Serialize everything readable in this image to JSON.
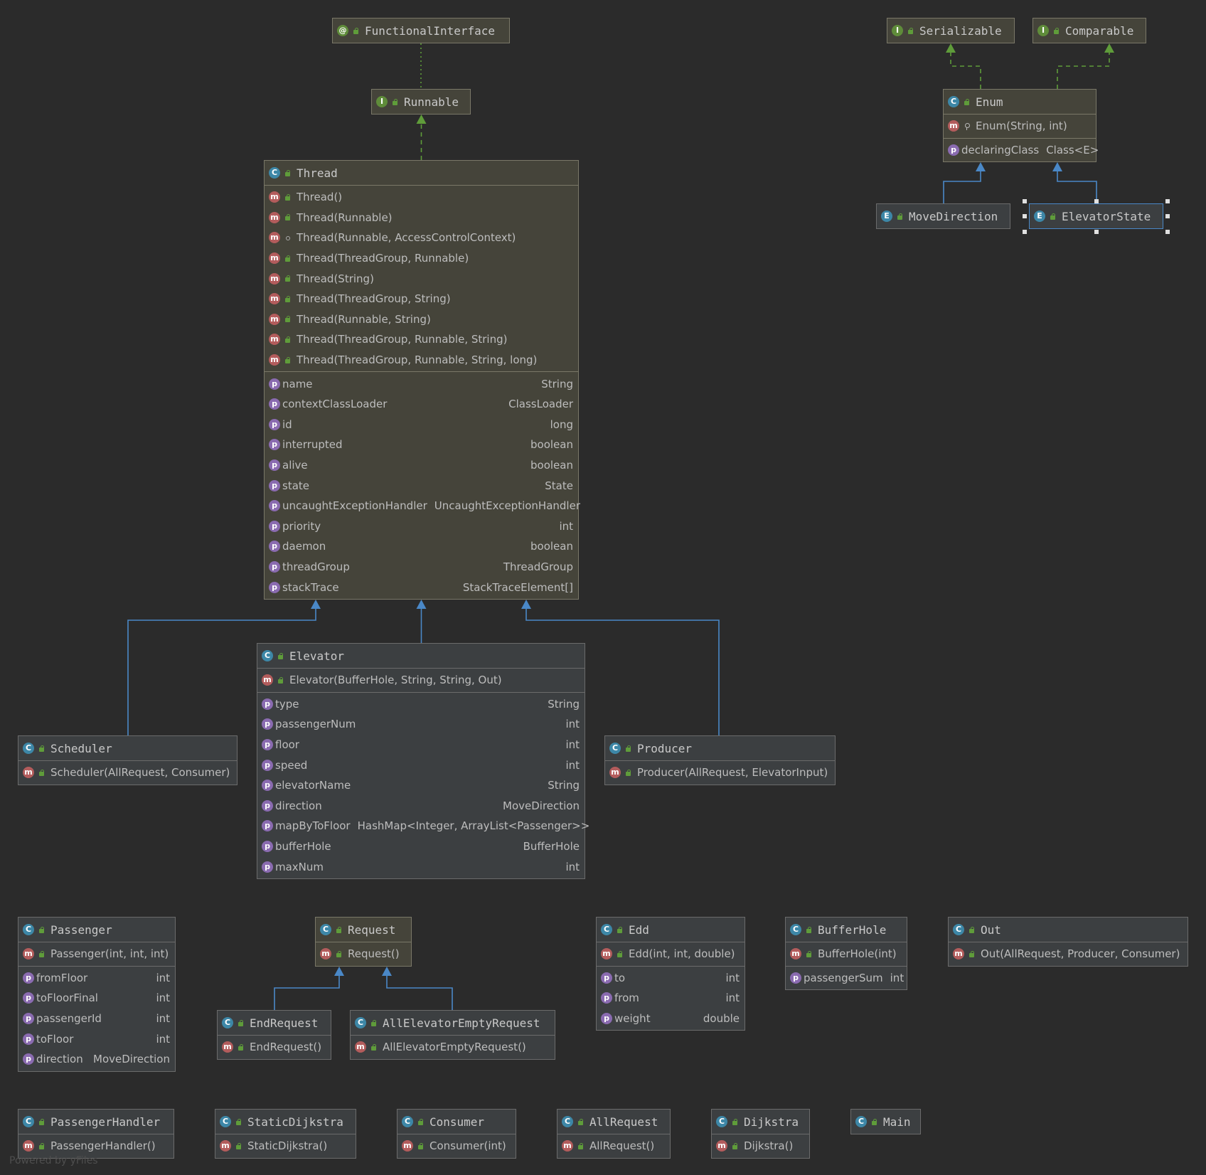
{
  "diagram": {
    "nodes": [
      {
        "id": "functionalinterface",
        "kind": "annotation",
        "name": "FunctionalInterface"
      },
      {
        "id": "runnable",
        "kind": "interface",
        "name": "Runnable"
      },
      {
        "id": "serializable",
        "kind": "interface",
        "name": "Serializable"
      },
      {
        "id": "comparable",
        "kind": "interface",
        "name": "Comparable"
      },
      {
        "id": "enum",
        "kind": "abstract-class",
        "name": "Enum",
        "methods": [
          {
            "vis": "private",
            "text": "Enum(String, int)"
          }
        ],
        "fields": [
          {
            "vis": "public",
            "name": "declaringClass",
            "type": "Class<E>"
          }
        ]
      },
      {
        "id": "movedirection",
        "kind": "enum",
        "name": "MoveDirection"
      },
      {
        "id": "elevatorstate",
        "kind": "enum",
        "name": "ElevatorState",
        "selected": true
      },
      {
        "id": "thread",
        "kind": "class",
        "name": "Thread",
        "methods": [
          {
            "vis": "public",
            "text": "Thread()"
          },
          {
            "vis": "public",
            "text": "Thread(Runnable)"
          },
          {
            "vis": "package",
            "text": "Thread(Runnable, AccessControlContext)"
          },
          {
            "vis": "public",
            "text": "Thread(ThreadGroup, Runnable)"
          },
          {
            "vis": "public",
            "text": "Thread(String)"
          },
          {
            "vis": "public",
            "text": "Thread(ThreadGroup, String)"
          },
          {
            "vis": "public",
            "text": "Thread(Runnable, String)"
          },
          {
            "vis": "public",
            "text": "Thread(ThreadGroup, Runnable, String)"
          },
          {
            "vis": "public",
            "text": "Thread(ThreadGroup, Runnable, String, long)"
          }
        ],
        "fields": [
          {
            "name": "name",
            "type": "String"
          },
          {
            "name": "contextClassLoader",
            "type": "ClassLoader"
          },
          {
            "name": "id",
            "type": "long"
          },
          {
            "name": "interrupted",
            "type": "boolean"
          },
          {
            "name": "alive",
            "type": "boolean"
          },
          {
            "name": "state",
            "type": "State"
          },
          {
            "name": "uncaughtExceptionHandler",
            "type": "UncaughtExceptionHandler"
          },
          {
            "name": "priority",
            "type": "int"
          },
          {
            "name": "daemon",
            "type": "boolean"
          },
          {
            "name": "threadGroup",
            "type": "ThreadGroup"
          },
          {
            "name": "stackTrace",
            "type": "StackTraceElement[]"
          }
        ]
      },
      {
        "id": "elevator",
        "kind": "class",
        "name": "Elevator",
        "methods": [
          {
            "vis": "public",
            "text": "Elevator(BufferHole, String, String, Out)"
          }
        ],
        "fields": [
          {
            "name": "type",
            "type": "String"
          },
          {
            "name": "passengerNum",
            "type": "int"
          },
          {
            "name": "floor",
            "type": "int"
          },
          {
            "name": "speed",
            "type": "int"
          },
          {
            "name": "elevatorName",
            "type": "String"
          },
          {
            "name": "direction",
            "type": "MoveDirection"
          },
          {
            "name": "mapByToFloor",
            "type": "HashMap<Integer, ArrayList<Passenger>>"
          },
          {
            "name": "bufferHole",
            "type": "BufferHole"
          },
          {
            "name": "maxNum",
            "type": "int"
          }
        ]
      },
      {
        "id": "scheduler",
        "kind": "class",
        "name": "Scheduler",
        "methods": [
          {
            "vis": "public",
            "text": "Scheduler(AllRequest, Consumer)"
          }
        ]
      },
      {
        "id": "producer",
        "kind": "class",
        "name": "Producer",
        "methods": [
          {
            "vis": "public",
            "text": "Producer(AllRequest, ElevatorInput)"
          }
        ]
      },
      {
        "id": "passenger",
        "kind": "class",
        "name": "Passenger",
        "methods": [
          {
            "vis": "public",
            "text": "Passenger(int, int, int)"
          }
        ],
        "fields": [
          {
            "name": "fromFloor",
            "type": "int"
          },
          {
            "name": "toFloorFinal",
            "type": "int"
          },
          {
            "name": "passengerId",
            "type": "int"
          },
          {
            "name": "toFloor",
            "type": "int"
          },
          {
            "name": "direction",
            "type": "MoveDirection"
          }
        ]
      },
      {
        "id": "request",
        "kind": "class",
        "name": "Request",
        "methods": [
          {
            "vis": "public",
            "text": "Request()"
          }
        ]
      },
      {
        "id": "endrequest",
        "kind": "class",
        "name": "EndRequest",
        "methods": [
          {
            "vis": "public",
            "text": "EndRequest()"
          }
        ]
      },
      {
        "id": "allelevatoremptyrequest",
        "kind": "class",
        "name": "AllElevatorEmptyRequest",
        "methods": [
          {
            "vis": "public",
            "text": "AllElevatorEmptyRequest()"
          }
        ]
      },
      {
        "id": "edd",
        "kind": "class",
        "name": "Edd",
        "methods": [
          {
            "vis": "public",
            "text": "Edd(int, int, double)"
          }
        ],
        "fields": [
          {
            "name": "to",
            "type": "int"
          },
          {
            "name": "from",
            "type": "int"
          },
          {
            "name": "weight",
            "type": "double"
          }
        ]
      },
      {
        "id": "bufferhole",
        "kind": "class",
        "name": "BufferHole",
        "methods": [
          {
            "vis": "public",
            "text": "BufferHole(int)"
          }
        ],
        "fields": [
          {
            "name": "passengerSum",
            "type": "int"
          }
        ]
      },
      {
        "id": "out",
        "kind": "class",
        "name": "Out",
        "methods": [
          {
            "vis": "public",
            "text": "Out(AllRequest, Producer, Consumer)"
          }
        ]
      },
      {
        "id": "passengerhandler",
        "kind": "class",
        "name": "PassengerHandler",
        "methods": [
          {
            "vis": "public",
            "text": "PassengerHandler()"
          }
        ]
      },
      {
        "id": "staticdijkstra",
        "kind": "class",
        "name": "StaticDijkstra",
        "methods": [
          {
            "vis": "public",
            "text": "StaticDijkstra()"
          }
        ]
      },
      {
        "id": "consumer",
        "kind": "class",
        "name": "Consumer",
        "methods": [
          {
            "vis": "public",
            "text": "Consumer(int)"
          }
        ]
      },
      {
        "id": "allrequest",
        "kind": "class",
        "name": "AllRequest",
        "methods": [
          {
            "vis": "public",
            "text": "AllRequest()"
          }
        ]
      },
      {
        "id": "dijkstra",
        "kind": "class",
        "name": "Dijkstra",
        "methods": [
          {
            "vis": "public",
            "text": "Dijkstra()"
          }
        ]
      },
      {
        "id": "main",
        "kind": "main-class",
        "name": "Main"
      }
    ],
    "edges": [
      {
        "from": "runnable",
        "to": "functionalinterface",
        "type": "annotation"
      },
      {
        "from": "thread",
        "to": "runnable",
        "type": "implements"
      },
      {
        "from": "enum",
        "to": "serializable",
        "type": "implements"
      },
      {
        "from": "enum",
        "to": "comparable",
        "type": "implements"
      },
      {
        "from": "movedirection",
        "to": "enum",
        "type": "extends"
      },
      {
        "from": "elevatorstate",
        "to": "enum",
        "type": "extends"
      },
      {
        "from": "scheduler",
        "to": "thread",
        "type": "extends"
      },
      {
        "from": "elevator",
        "to": "thread",
        "type": "extends"
      },
      {
        "from": "producer",
        "to": "thread",
        "type": "extends"
      },
      {
        "from": "endrequest",
        "to": "request",
        "type": "extends"
      },
      {
        "from": "allelevatoremptyrequest",
        "to": "request",
        "type": "extends"
      }
    ],
    "colors": {
      "background": "#2b2b2b",
      "extends_edge": "#4a88c7",
      "implements_edge": "#5f9c3a",
      "icon_class": "#3d87a7",
      "icon_interface": "#5f8c3a",
      "icon_method": "#b35c5c",
      "icon_property": "#8a6bb0"
    },
    "footer": "Powered by yFiles"
  }
}
